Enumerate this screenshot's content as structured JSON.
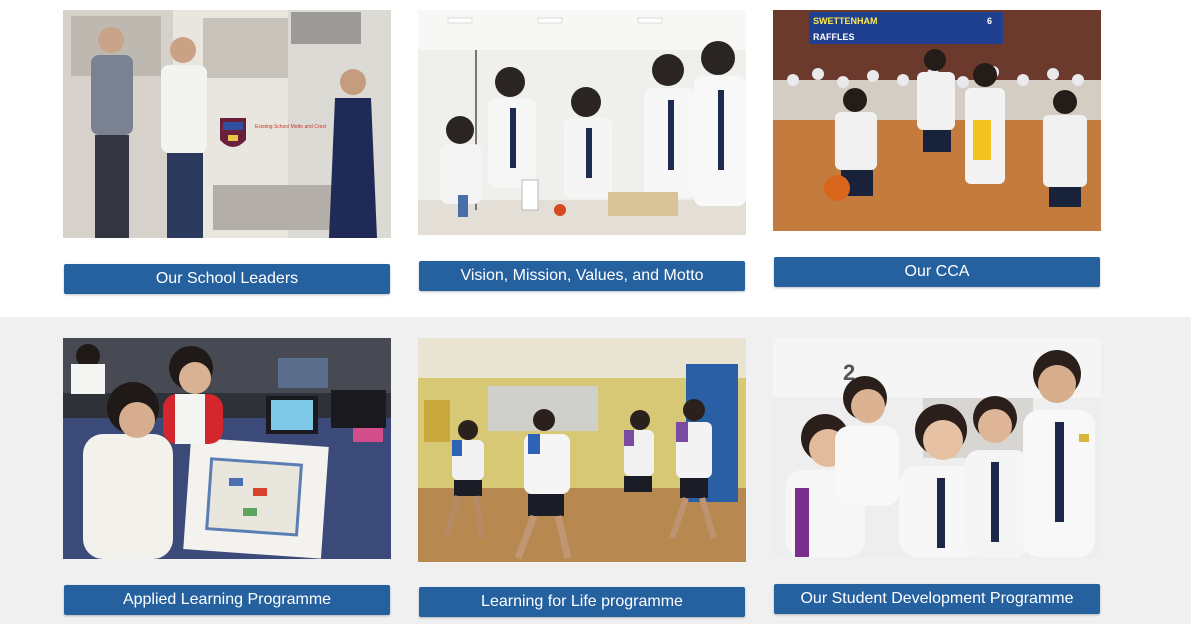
{
  "cards": [
    {
      "label": "Our School Leaders",
      "photo": "school-leaders-photo",
      "caption": "Existing School Motto and Crest"
    },
    {
      "label": "Vision, Mission, Values, and Motto",
      "photo": "science-lab-photo"
    },
    {
      "label": "Our CCA",
      "photo": "cca-sports-photo",
      "scoreboard": {
        "team1": "SWETTENHAM",
        "score1": "6",
        "team2": "RAFFLES"
      }
    },
    {
      "label": "Applied Learning Programme",
      "photo": "board-game-photo"
    },
    {
      "label": "Learning for Life programme",
      "photo": "netball-photo"
    },
    {
      "label": "Our Student Development Programme",
      "photo": "students-group-photo",
      "wall_number": "2"
    }
  ],
  "colors": {
    "button": "#25609f",
    "button_text": "#ffffff",
    "top_band": "#ffffff",
    "bottom_band": "#f0f0f0"
  }
}
